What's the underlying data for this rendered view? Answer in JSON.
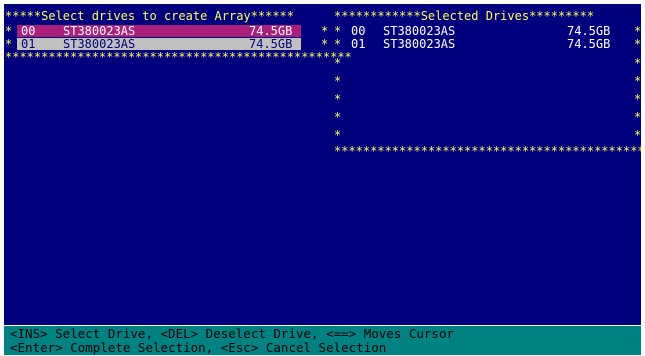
{
  "left_panel": {
    "title": "Select drives to create Array",
    "drives": [
      {
        "index": "00",
        "model": "ST380023AS",
        "capacity": "74.5GB",
        "state": "highlighted"
      },
      {
        "index": "01",
        "model": "ST380023AS",
        "capacity": "74.5GB",
        "state": "selected"
      }
    ]
  },
  "right_panel": {
    "title": "Selected Drives",
    "drives": [
      {
        "index": "00",
        "model": "ST380023AS",
        "capacity": "74.5GB"
      },
      {
        "index": "01",
        "model": "ST380023AS",
        "capacity": "74.5GB"
      }
    ]
  },
  "status_bar": {
    "line1": "<INS> Select Drive, <DEL> Deselect Drive, <==> Moves Cursor",
    "line2": "<Enter> Complete Selection, <Esc> Cancel Selection"
  },
  "colors": {
    "background": "#00007e",
    "border": "#ffff55",
    "highlight_row": "#aa1f7a",
    "selected_row": "#c0c0c0",
    "status_bar": "#008282"
  }
}
